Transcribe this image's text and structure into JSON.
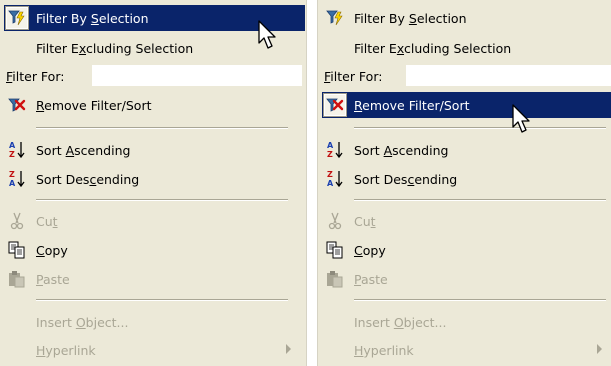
{
  "menus": [
    {
      "filter_by_selection": {
        "pre": "Filter By ",
        "key": "S",
        "post": "election"
      },
      "filter_excluding": {
        "pre": "Filter E",
        "key": "x",
        "post": "cluding Selection"
      },
      "filter_for": {
        "pre": "",
        "key": "F",
        "post": "ilter For:"
      },
      "remove_filter": {
        "pre": "",
        "key": "R",
        "post": "emove Filter/Sort"
      },
      "sort_ascending": {
        "pre": "Sort ",
        "key": "A",
        "post": "scending"
      },
      "sort_descending": {
        "pre": "Sort Des",
        "key": "c",
        "post": "ending"
      },
      "cut": {
        "pre": "Cu",
        "key": "t",
        "post": ""
      },
      "copy": {
        "pre": "",
        "key": "C",
        "post": "opy"
      },
      "paste": {
        "pre": "",
        "key": "P",
        "post": "aste"
      },
      "insert_object": {
        "pre": "Insert ",
        "key": "O",
        "post": "bject..."
      },
      "hyperlink": {
        "pre": "",
        "key": "H",
        "post": "yperlink"
      },
      "highlighted": "filter-by-selection"
    },
    {
      "filter_by_selection": {
        "pre": "Filter By ",
        "key": "S",
        "post": "election"
      },
      "filter_excluding": {
        "pre": "Filter E",
        "key": "x",
        "post": "cluding Selection"
      },
      "filter_for": {
        "pre": "",
        "key": "F",
        "post": "ilter For:"
      },
      "remove_filter": {
        "pre": "",
        "key": "R",
        "post": "emove Filter/Sort"
      },
      "sort_ascending": {
        "pre": "Sort ",
        "key": "A",
        "post": "scending"
      },
      "sort_descending": {
        "pre": "Sort Des",
        "key": "c",
        "post": "ending"
      },
      "cut": {
        "pre": "Cu",
        "key": "t",
        "post": ""
      },
      "copy": {
        "pre": "",
        "key": "C",
        "post": "opy"
      },
      "paste": {
        "pre": "",
        "key": "P",
        "post": "aste"
      },
      "insert_object": {
        "pre": "Insert ",
        "key": "O",
        "post": "bject..."
      },
      "hyperlink": {
        "pre": "",
        "key": "H",
        "post": "yperlink"
      },
      "highlighted": "remove-filter-sort"
    }
  ],
  "colors": {
    "menu_bg": "#ece9d8",
    "highlight_bg": "#0a246a",
    "highlight_text": "#ffffff",
    "disabled_text": "#a9a695"
  },
  "icons": {
    "filter_by_selection": "filter-lightning-icon",
    "remove_filter": "remove-filter-icon",
    "sort_ascending": "sort-ascending-icon",
    "sort_descending": "sort-descending-icon",
    "cut": "scissors-icon",
    "copy": "copy-icon",
    "paste": "paste-icon",
    "submenu_arrow": "submenu-arrow-icon",
    "cursor": "mouse-cursor-icon"
  }
}
